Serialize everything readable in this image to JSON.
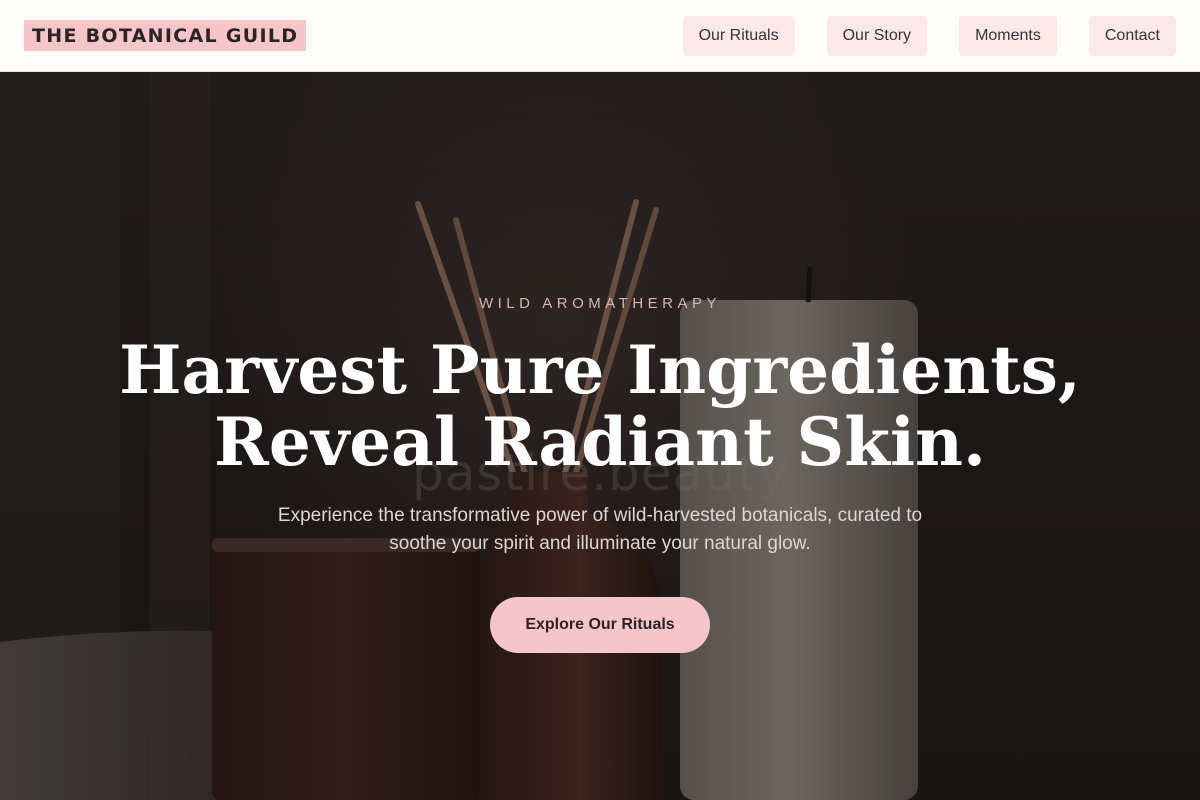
{
  "brand": {
    "name": "THE BOTANICAL GUILD"
  },
  "nav": {
    "items": [
      {
        "label": "Our Rituals"
      },
      {
        "label": "Our Story"
      },
      {
        "label": "Moments"
      },
      {
        "label": "Contact"
      }
    ]
  },
  "hero": {
    "eyebrow": "WILD AROMATHERAPY",
    "headline_line1": "Harvest Pure Ingredients,",
    "headline_line2": "Reveal Radiant Skin.",
    "subtext": "Experience the transformative power of wild-harvested botanicals, curated to soothe your spirit and illuminate your natural glow.",
    "cta_label": "Explore Our Rituals",
    "watermark": "pastire.beauty"
  },
  "colors": {
    "accent": "#f4c6c9",
    "nav_bg": "#fbe9ea",
    "header_bg": "#fffcfa",
    "eyebrow": "#d9b3b4"
  }
}
